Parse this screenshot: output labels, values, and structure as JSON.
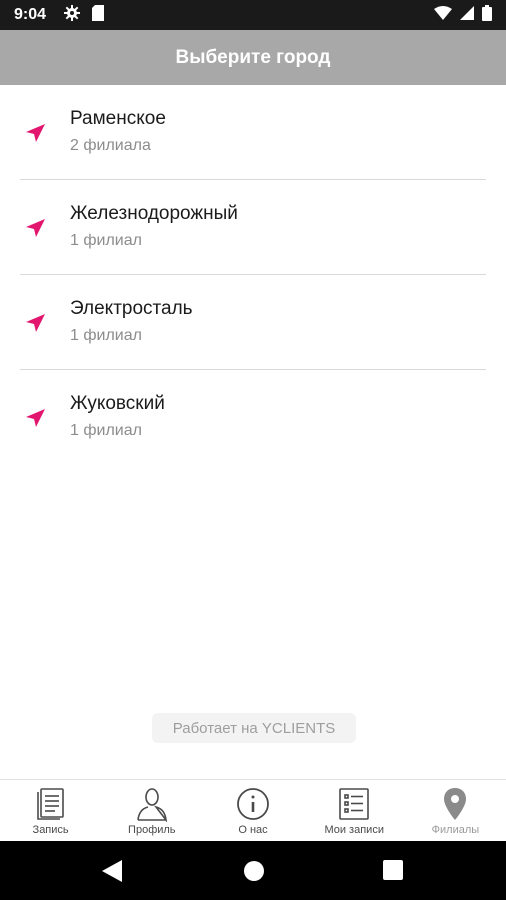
{
  "status_bar": {
    "time": "9:04",
    "icons": [
      "gear-icon",
      "sd-card-icon",
      "wifi-icon",
      "signal-icon",
      "battery-icon"
    ]
  },
  "header": {
    "title": "Выберите город"
  },
  "cities": [
    {
      "name": "Раменское",
      "count": "2 филиала"
    },
    {
      "name": "Железнодорожный",
      "count": "1 филиал"
    },
    {
      "name": "Электросталь",
      "count": "1 филиал"
    },
    {
      "name": "Жуковский",
      "count": "1 филиал"
    }
  ],
  "powered_by": "Работает на YCLIENTS",
  "bottom_nav": [
    {
      "label": "Запись",
      "icon": "document-icon"
    },
    {
      "label": "Профиль",
      "icon": "person-icon"
    },
    {
      "label": "О нас",
      "icon": "info-icon"
    },
    {
      "label": "Мои записи",
      "icon": "list-icon"
    },
    {
      "label": "Филиалы",
      "icon": "map-pin-icon"
    }
  ],
  "colors": {
    "accent": "#e2166f",
    "header_bg": "#a8a8a8",
    "status_bar_bg": "#1a1a1a"
  }
}
